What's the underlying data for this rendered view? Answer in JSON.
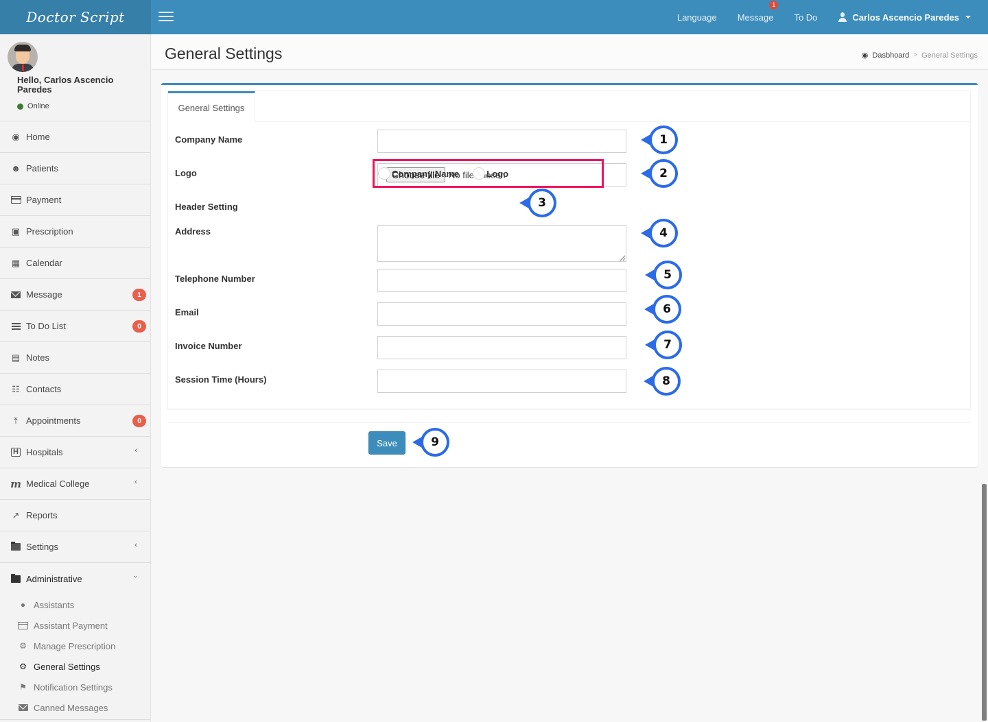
{
  "app": {
    "logo": "Doctor Script"
  },
  "topnav": {
    "language": "Language",
    "message": "Message",
    "message_badge": "1",
    "todo": "To Do",
    "user_name": "Carlos Ascencio Paredes"
  },
  "user_panel": {
    "greeting": "Hello, Carlos Ascencio Paredes",
    "status": "Online",
    "status_color": "#3c7d33"
  },
  "sidebar": {
    "items": [
      {
        "label": "Home",
        "icon": "dashboard-icon"
      },
      {
        "label": "Patients",
        "icon": "users-icon"
      },
      {
        "label": "Payment",
        "icon": "credit-card-icon"
      },
      {
        "label": "Prescription",
        "icon": "medkit-icon"
      },
      {
        "label": "Calendar",
        "icon": "calendar-icon"
      },
      {
        "label": "Message",
        "icon": "envelope-icon",
        "badge": "1"
      },
      {
        "label": "To Do List",
        "icon": "bars-icon",
        "badge": "0"
      },
      {
        "label": "Notes",
        "icon": "file-text-icon"
      },
      {
        "label": "Contacts",
        "icon": "newspaper-icon"
      },
      {
        "label": "Appointments",
        "icon": "thumbtack-icon",
        "badge": "0"
      },
      {
        "label": "Hospitals",
        "icon": "hospital-icon",
        "expandable": true
      },
      {
        "label": "Medical College",
        "icon": "college-m-icon",
        "expandable": true
      },
      {
        "label": "Reports",
        "icon": "line-chart-icon"
      },
      {
        "label": "Settings",
        "icon": "folder-icon",
        "expandable": true
      },
      {
        "label": "Administrative",
        "icon": "folder-icon",
        "expanded": true
      }
    ],
    "submenu": [
      {
        "label": "Assistants",
        "icon": "user-icon"
      },
      {
        "label": "Assistant Payment",
        "icon": "credit-card-icon"
      },
      {
        "label": "Manage Prescription",
        "icon": "cogs-icon"
      },
      {
        "label": "General Settings",
        "icon": "cogs-icon",
        "active": true
      },
      {
        "label": "Notification Settings",
        "icon": "bell-icon"
      },
      {
        "label": "Canned Messages",
        "icon": "envelope-icon"
      }
    ]
  },
  "page": {
    "title": "General Settings",
    "breadcrumb": {
      "home": "Dasbhoard",
      "separator": ">",
      "current": "General Settings"
    }
  },
  "form": {
    "tab": "General Settings",
    "fields": {
      "company_name": {
        "label": "Company Name",
        "value": ""
      },
      "logo": {
        "label": "Logo",
        "button": "Choose file",
        "status": "No file chosen"
      },
      "header_setting": {
        "label": "Header Setting",
        "options": [
          "Company Name",
          "Logo"
        ],
        "selected": null
      },
      "address": {
        "label": "Address",
        "value": ""
      },
      "telephone": {
        "label": "Telephone Number",
        "value": ""
      },
      "email": {
        "label": "Email",
        "value": ""
      },
      "invoice_number": {
        "label": "Invoice Number",
        "value": ""
      },
      "session_time": {
        "label": "Session Time (Hours)",
        "value": ""
      }
    },
    "save_label": "Save"
  },
  "annotations": [
    "1",
    "2",
    "3",
    "4",
    "5",
    "6",
    "7",
    "8",
    "9"
  ],
  "colors": {
    "brand": "#3c8dbc",
    "brand_dark": "#367fa9",
    "badge": "#e8604c",
    "highlight_box": "#f0145a",
    "callout": "#2b6be8"
  }
}
